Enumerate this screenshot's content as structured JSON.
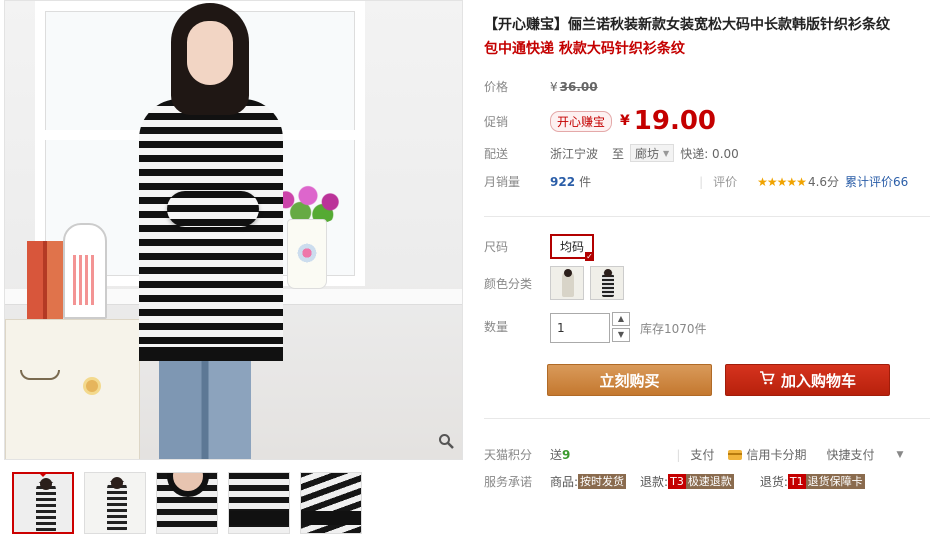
{
  "product": {
    "title": "【开心赚宝】俪兰诺秋装新款女装宽松大码中长款韩版针织衫条纹",
    "subtitle": "包中通快递 秋款大码针织衫条纹"
  },
  "price": {
    "label": "价格",
    "currency": "¥",
    "original": "36.00"
  },
  "promo": {
    "label": "促销",
    "tag": "开心赚宝",
    "currency": "¥",
    "value": "19.00"
  },
  "delivery": {
    "label": "配送",
    "origin": "浙江宁波",
    "to": "至",
    "destination": "廊坊",
    "express": "快递: 0.00"
  },
  "sales": {
    "label": "月销量",
    "count": "922",
    "unit": "件",
    "rating_label": "评价",
    "stars": "★★★★★",
    "score": "4.6分",
    "reviews": "累计评价66"
  },
  "options": {
    "size_label": "尺码",
    "size_value": "均码",
    "color_label": "颜色分类"
  },
  "quantity": {
    "label": "数量",
    "value": "1",
    "stock": "库存1070件"
  },
  "buttons": {
    "buy": "立刻购买",
    "cart": "加入购物车"
  },
  "extras": {
    "points_label": "天猫积分",
    "points_prefix": "送",
    "points_value": "9",
    "pay_label": "支付",
    "card_pay": "信用卡分期",
    "quick_pay": "快捷支付"
  },
  "promise": {
    "label": "服务承诺",
    "goods_k": "商品:",
    "goods_v": "按时发货",
    "refund_k": "退款:",
    "refund_badge": "T3",
    "refund_v": "极速退款",
    "return_k": "退货:",
    "return_badge": "T1",
    "return_v": "退货保障卡"
  },
  "icons": {
    "zoom": "magnifier-icon",
    "cart": "cart-icon",
    "card": "credit-card-icon"
  },
  "colors": {
    "accent_red": "#c40000",
    "buy_orange": "#c4782f",
    "cart_red": "#b8210c",
    "link_blue": "#2b5ea8",
    "star_gold": "#f0a300"
  }
}
